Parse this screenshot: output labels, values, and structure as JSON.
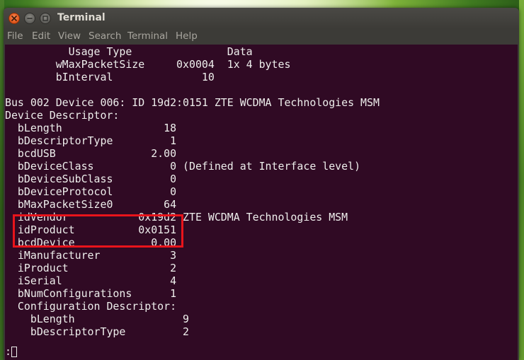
{
  "window": {
    "title": "Terminal",
    "controls": [
      "close-icon",
      "minimize-icon",
      "maximize-icon"
    ],
    "accent_close": "#e55b1f"
  },
  "menubar": {
    "items": [
      "File",
      "Edit",
      "View",
      "Search",
      "Terminal",
      "Help"
    ]
  },
  "terminal": {
    "background": "#300a24",
    "foreground": "#eeeeec",
    "lines": [
      "          Usage Type               Data",
      "        wMaxPacketSize     0x0004  1x 4 bytes",
      "        bInterval              10",
      "",
      "Bus 002 Device 006: ID 19d2:0151 ZTE WCDMA Technologies MSM",
      "Device Descriptor:",
      "  bLength                18",
      "  bDescriptorType         1",
      "  bcdUSB               2.00",
      "  bDeviceClass            0 (Defined at Interface level)",
      "  bDeviceSubClass         0",
      "  bDeviceProtocol         0",
      "  bMaxPacketSize0        64",
      "  idVendor           0x19d2 ZTE WCDMA Technologies MSM",
      "  idProduct          0x0151",
      "  bcdDevice            0.00",
      "  iManufacturer           3",
      "  iProduct                2",
      "  iSerial                 4",
      "  bNumConfigurations      1",
      "  Configuration Descriptor:",
      "    bLength                 9",
      "    bDescriptorType         2"
    ],
    "prompt": ":",
    "highlight_color": "#e8141b",
    "highlighted_lines": [
      "idVendor",
      "idProduct"
    ]
  }
}
